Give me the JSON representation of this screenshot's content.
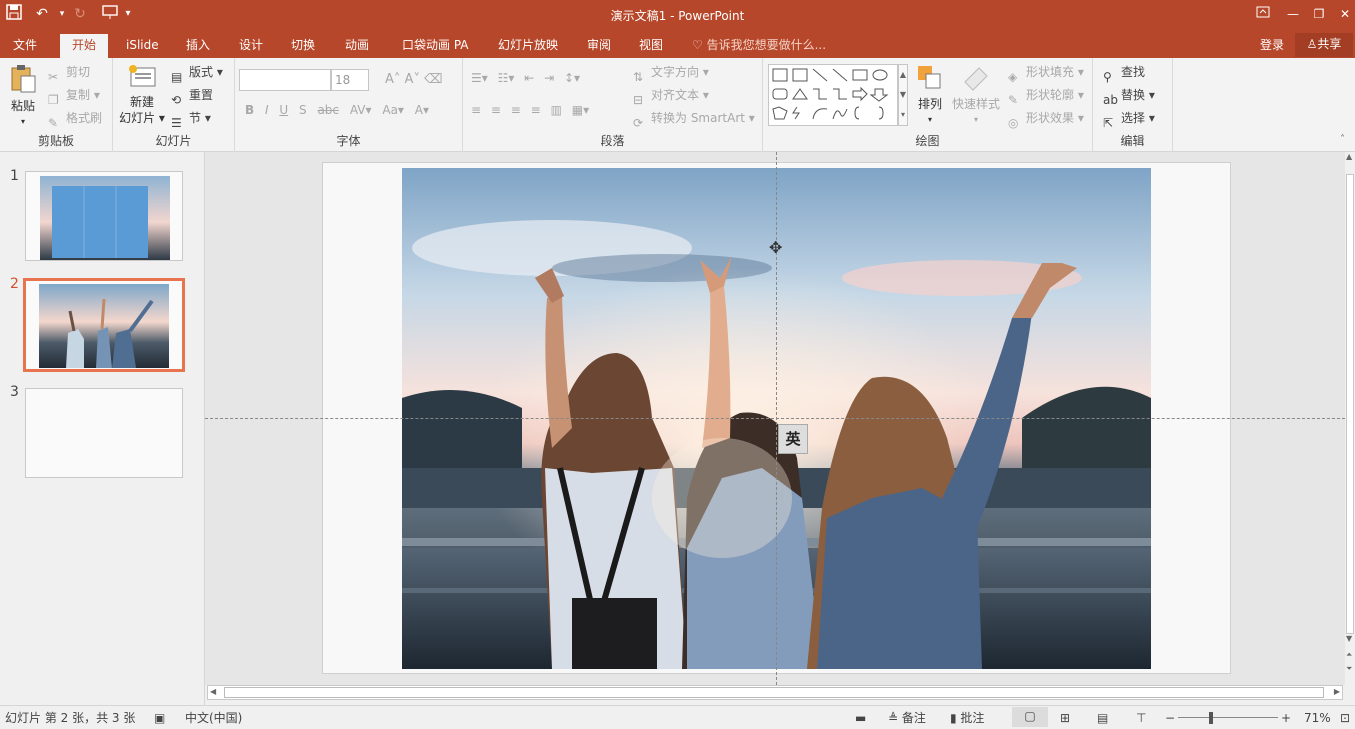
{
  "title_bar": {
    "title": "演示文稿1 - PowerPoint",
    "save_icon": "save-icon",
    "undo_icon": "undo-icon",
    "redo_icon": "redo-icon",
    "present_icon": "present-from-start-icon"
  },
  "tabs": [
    {
      "label": "文件"
    },
    {
      "label": "开始"
    },
    {
      "label": "iSlide"
    },
    {
      "label": "插入"
    },
    {
      "label": "设计"
    },
    {
      "label": "切换"
    },
    {
      "label": "动画"
    },
    {
      "label": "口袋动画 PA"
    },
    {
      "label": "幻灯片放映"
    },
    {
      "label": "审阅"
    },
    {
      "label": "视图"
    }
  ],
  "tell_me": "告诉我您想要做什么...",
  "account": {
    "login": "登录",
    "share": "共享"
  },
  "ribbon": {
    "clipboard": {
      "label": "剪贴板",
      "paste": "粘贴",
      "cut": "剪切",
      "copy": "复制",
      "format_painter": "格式刷"
    },
    "slides": {
      "label": "幻灯片",
      "new_slide_line1": "新建",
      "new_slide_line2": "幻灯片",
      "layout": "版式",
      "reset": "重置",
      "section": "节"
    },
    "font": {
      "label": "字体",
      "font_name": "",
      "font_size": "18"
    },
    "paragraph": {
      "label": "段落",
      "text_direction": "文字方向",
      "align_text": "对齐文本",
      "smartart": "转换为 SmartArt"
    },
    "drawing": {
      "label": "绘图",
      "arrange": "排列",
      "quick_styles": "快速样式",
      "shape_fill": "形状填充",
      "shape_outline": "形状轮廓",
      "shape_effects": "形状效果"
    },
    "editing": {
      "label": "编辑",
      "find": "查找",
      "replace": "替换",
      "select": "选择"
    }
  },
  "slides": [
    {
      "number": "1"
    },
    {
      "number": "2"
    },
    {
      "number": "3"
    }
  ],
  "ime_indicator": "英",
  "status": {
    "slide_info": "幻灯片 第 2 张，共 3 张",
    "language": "中文(中国)",
    "notes": "备注",
    "comments": "批注",
    "zoom": "71%"
  },
  "colors": {
    "accent": "#b7472a",
    "selection": "#e8744f"
  }
}
